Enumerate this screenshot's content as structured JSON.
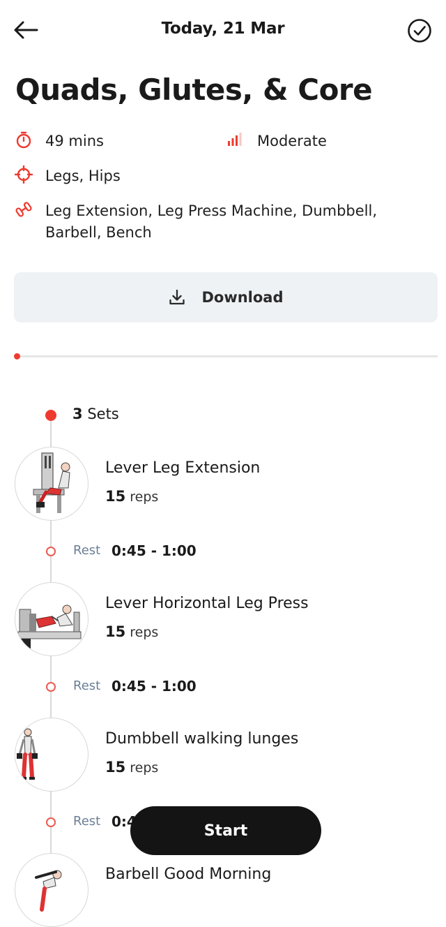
{
  "header": {
    "title": "Today, 21 Mar",
    "back_icon": "arrow-left-icon",
    "done_icon": "check-circle-icon"
  },
  "workout": {
    "title": "Quads, Glutes, & Core",
    "duration": "49 mins",
    "difficulty": "Moderate",
    "target": "Legs, Hips",
    "equipment": "Leg Extension, Leg Press Machine, Dumbbell, Barbell, Bench"
  },
  "download_label": "Download",
  "progress": 0,
  "sets": {
    "count": "3",
    "label": "Sets"
  },
  "exercises": [
    {
      "name": "Lever Leg Extension",
      "reps": "15",
      "reps_unit": "reps"
    },
    {
      "name": "Lever Horizontal Leg Press",
      "reps": "15",
      "reps_unit": "reps"
    },
    {
      "name": "Dumbbell walking lunges",
      "reps": "15",
      "reps_unit": "reps"
    },
    {
      "name": "Barbell Good Morning"
    }
  ],
  "rests": [
    {
      "label": "Rest",
      "time": "0:45 - 1:00"
    },
    {
      "label": "Rest",
      "time": "0:45 - 1:00"
    },
    {
      "label": "Rest",
      "time": "0:4"
    }
  ],
  "start_label": "Start",
  "colors": {
    "accent": "#ee3a2f",
    "button_dark": "#141414",
    "download_bg": "#eef2f5",
    "rest_label": "#6b7f96"
  }
}
